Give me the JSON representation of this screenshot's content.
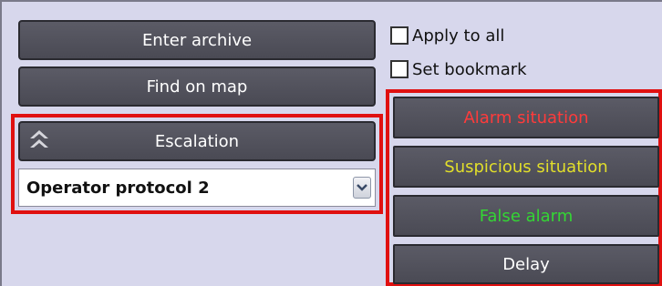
{
  "buttons": {
    "enter_archive": "Enter archive",
    "find_on_map": "Find on map",
    "escalation": "Escalation"
  },
  "protocol_select": {
    "value": "Operator protocol 2"
  },
  "checkboxes": {
    "apply_to_all": "Apply to all",
    "set_bookmark": "Set bookmark"
  },
  "situations": {
    "alarm": "Alarm situation",
    "suspicious": "Suspicious situation",
    "false_alarm": "False alarm",
    "delay": "Delay"
  },
  "colors": {
    "alarm_text": "#ff3b3b",
    "suspicious_text": "#e2df2a",
    "false_alarm_text": "#34d634",
    "highlight_border": "#e01010"
  },
  "icons": {
    "escalation": "double-chevron-up-icon",
    "select_arrow": "chevron-down-icon"
  }
}
